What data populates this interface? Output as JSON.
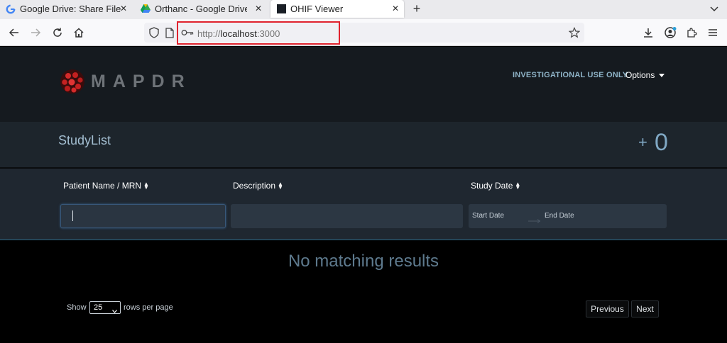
{
  "browser": {
    "tabs": [
      {
        "title": "Google Drive: Share Files",
        "favicon": "google-g-icon"
      },
      {
        "title": "Orthanc - Google Drive",
        "favicon": "google-drive-icon"
      },
      {
        "title": "OHIF Viewer",
        "favicon": "ohif-icon",
        "active": true
      }
    ],
    "url": {
      "scheme": "http://",
      "host": "localhost",
      "port": ":3000"
    }
  },
  "header": {
    "logo_text": "MAPDR",
    "notice": "INVESTIGATIONAL USE ONLY",
    "options_label": "Options"
  },
  "studylist": {
    "title": "StudyList",
    "add_symbol": "+",
    "count": "0"
  },
  "filters": {
    "columns": [
      {
        "label": "Patient Name / MRN"
      },
      {
        "label": "Description"
      },
      {
        "label": "Study Date"
      }
    ],
    "start_date_placeholder": "Start Date",
    "end_date_placeholder": "End Date"
  },
  "results": {
    "empty_message": "No matching results"
  },
  "pagination": {
    "show_label": "Show",
    "rows_value": "25",
    "rows_suffix": "rows per page",
    "previous_label": "Previous",
    "next_label": "Next"
  },
  "colors": {
    "accent": "#80a8c4",
    "header_bg": "#151a1f",
    "panel_bg": "#1f2730",
    "url_highlight": "#e0232e"
  }
}
